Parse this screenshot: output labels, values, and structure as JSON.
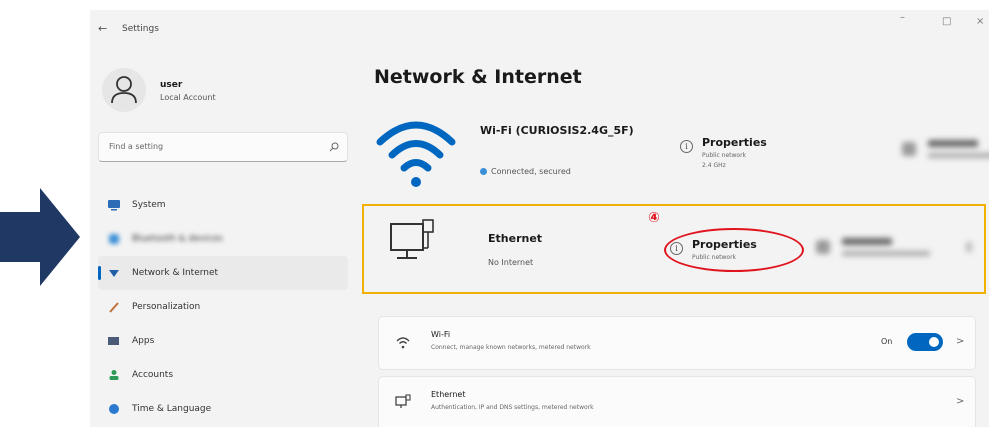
{
  "window": {
    "back_glyph": "←",
    "title": "Settings",
    "controls": {
      "minimize": "–",
      "maximize": "□",
      "close": "×"
    }
  },
  "user": {
    "name": "user",
    "account": "Local Account"
  },
  "search": {
    "placeholder": "Find a setting"
  },
  "nav": [
    {
      "label": "System",
      "icon": "monitor-icon"
    },
    {
      "label": "Bluetooth & devices",
      "icon": "bluetooth-icon"
    },
    {
      "label": "Network & Internet",
      "icon": "network-icon",
      "active": true
    },
    {
      "label": "Personalization",
      "icon": "brush-icon"
    },
    {
      "label": "Apps",
      "icon": "apps-icon"
    },
    {
      "label": "Accounts",
      "icon": "person-icon"
    },
    {
      "label": "Time & Language",
      "icon": "globe-icon"
    }
  ],
  "page": {
    "title": "Network & Internet"
  },
  "wifi_hero": {
    "name": "Wi-Fi (CURIOSIS2.4G_5F)",
    "status": "Connected, secured",
    "properties_label": "Properties",
    "properties_sub1": "Public network",
    "properties_sub2": "2.4 GHz"
  },
  "ethernet_hero": {
    "name": "Ethernet",
    "status": "No Internet",
    "properties_label": "Properties",
    "properties_sub1": "Public network",
    "step_marker": "④"
  },
  "list": [
    {
      "title": "Wi-Fi",
      "subtitle": "Connect, manage known networks, metered network",
      "toggle_text": "On",
      "toggle_on": true,
      "chevron": ">"
    },
    {
      "title": "Ethernet",
      "subtitle": "Authentication, IP and DNS settings, metered network",
      "chevron": ">"
    }
  ],
  "colors": {
    "accent": "#0067c0",
    "highlight_box": "#f2b000",
    "annotation": "#e0141e",
    "arrow": "#203864"
  }
}
